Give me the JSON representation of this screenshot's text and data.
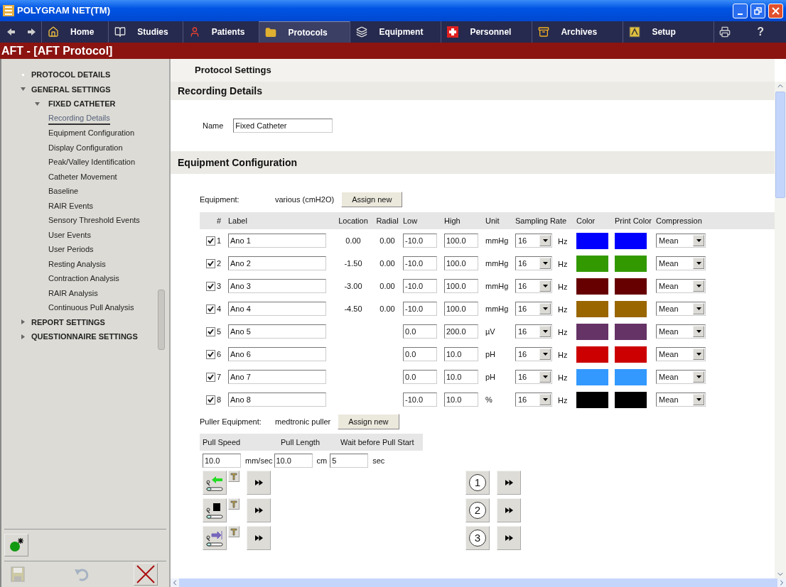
{
  "window": {
    "title": "POLYGRAM NET(TM)"
  },
  "nav": {
    "tabs": [
      {
        "label": "Home",
        "selected": false
      },
      {
        "label": "Studies",
        "selected": false
      },
      {
        "label": "Patients",
        "selected": false
      },
      {
        "label": "Protocols",
        "selected": true
      },
      {
        "label": "Equipment",
        "selected": false
      },
      {
        "label": "Personnel",
        "selected": false
      },
      {
        "label": "Archives",
        "selected": false
      },
      {
        "label": "Setup",
        "selected": false
      }
    ],
    "help": "?"
  },
  "header": {
    "title": "AFT - [AFT Protocol]"
  },
  "sidebar": {
    "tree": [
      {
        "label": "PROTOCOL DETAILS",
        "selected": false
      },
      {
        "label": "GENERAL SETTINGS",
        "selected": false,
        "expanded": true,
        "children": [
          {
            "label": "FIXED CATHETER",
            "selected": false,
            "expanded": true,
            "children": [
              {
                "label": "Recording Details",
                "selected": true
              },
              {
                "label": "Equipment Configuration",
                "selected": false
              },
              {
                "label": "Display Configuration",
                "selected": false
              },
              {
                "label": "Peak/Valley Identification",
                "selected": false
              },
              {
                "label": "Catheter Movement",
                "selected": false
              },
              {
                "label": "Baseline",
                "selected": false
              },
              {
                "label": "RAIR Events",
                "selected": false
              },
              {
                "label": "Sensory Threshold Events",
                "selected": false
              },
              {
                "label": "User Events",
                "selected": false
              },
              {
                "label": "User Periods",
                "selected": false
              },
              {
                "label": "Resting Analysis",
                "selected": false
              },
              {
                "label": "Contraction Analysis",
                "selected": false
              },
              {
                "label": "RAIR Analysis",
                "selected": false
              },
              {
                "label": "Continuous Pull Analysis",
                "selected": false
              }
            ]
          }
        ]
      },
      {
        "label": "REPORT SETTINGS",
        "selected": false,
        "expanded": false
      },
      {
        "label": "QUESTIONNAIRE SETTINGS",
        "selected": false,
        "expanded": false
      }
    ],
    "buttons": [
      {
        "kind": "new",
        "disabled": false
      },
      {
        "kind": "save",
        "disabled": true
      },
      {
        "kind": "undo",
        "disabled": true
      },
      {
        "kind": "close",
        "disabled": false
      }
    ]
  },
  "main": {
    "title": "Protocol Settings",
    "recording": {
      "heading": "Recording Details",
      "name_label": "Name",
      "name_value": "Fixed Catheter"
    },
    "equipment": {
      "heading": "Equipment Configuration",
      "label": "Equipment:",
      "value": "various (cmH2O)",
      "button": "Assign new",
      "columns": [
        "#",
        "Label",
        "Location",
        "Radial",
        "Low",
        "High",
        "Unit",
        "Sampling Rate",
        "Color",
        "Print Color",
        "Compression"
      ],
      "rows": [
        {
          "checked": true,
          "number": "1",
          "label": "Ano 1",
          "location": "0.00",
          "radial": "0.00",
          "low": "-10.0",
          "high": "100.0",
          "unit": "mmHg",
          "rate": "16",
          "rate_unit": "Hz",
          "color": "#0000ff",
          "compression": "Mean"
        },
        {
          "checked": true,
          "number": "2",
          "label": "Ano 2",
          "location": "-1.50",
          "radial": "0.00",
          "low": "-10.0",
          "high": "100.0",
          "unit": "mmHg",
          "rate": "16",
          "rate_unit": "Hz",
          "color": "#339900",
          "compression": "Mean"
        },
        {
          "checked": true,
          "number": "3",
          "label": "Ano 3",
          "location": "-3.00",
          "radial": "0.00",
          "low": "-10.0",
          "high": "100.0",
          "unit": "mmHg",
          "rate": "16",
          "rate_unit": "Hz",
          "color": "#660000",
          "compression": "Mean"
        },
        {
          "checked": true,
          "number": "4",
          "label": "Ano 4",
          "location": "-4.50",
          "radial": "0.00",
          "low": "-10.0",
          "high": "100.0",
          "unit": "mmHg",
          "rate": "16",
          "rate_unit": "Hz",
          "color": "#996600",
          "compression": "Mean"
        },
        {
          "checked": true,
          "number": "5",
          "label": "Ano 5",
          "low": "0.0",
          "high": "200.0",
          "unit": "µV",
          "rate": "16",
          "rate_unit": "Hz",
          "color": "#663366",
          "compression": "Mean"
        },
        {
          "checked": true,
          "number": "6",
          "label": "Ano 6",
          "low": "0.0",
          "high": "10.0",
          "unit": "pH",
          "rate": "16",
          "rate_unit": "Hz",
          "color": "#cc0000",
          "compression": "Mean"
        },
        {
          "checked": true,
          "number": "7",
          "label": "Ano 7",
          "low": "0.0",
          "high": "10.0",
          "unit": "pH",
          "rate": "16",
          "rate_unit": "Hz",
          "color": "#3399ff",
          "compression": "Mean"
        },
        {
          "checked": true,
          "number": "8",
          "label": "Ano 8",
          "low": "-10.0",
          "high": "10.0",
          "unit": "%",
          "rate": "16",
          "rate_unit": "Hz",
          "color": "#000000",
          "compression": "Mean"
        }
      ]
    },
    "puller": {
      "label": "Puller Equipment:",
      "value": "medtronic puller",
      "button": "Assign new",
      "columns": [
        "Pull Speed",
        "Pull Length",
        "Wait before Pull Start"
      ],
      "fields": [
        {
          "value": "10.0",
          "unit": "mm/sec"
        },
        {
          "value": "10.0",
          "unit": "cm"
        },
        {
          "value": "5",
          "unit": "sec"
        }
      ],
      "moves": [
        {
          "kind": "back"
        },
        {
          "kind": "stop"
        },
        {
          "kind": "forward"
        }
      ],
      "positions": [
        "1",
        "2",
        "3"
      ]
    }
  }
}
